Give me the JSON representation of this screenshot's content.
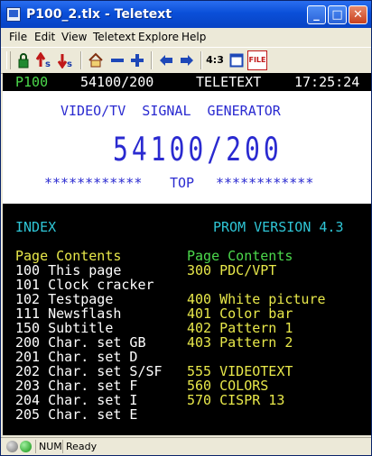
{
  "window": {
    "title": "P100_2.tlx - Teletext",
    "buttons": {
      "minimize": "_",
      "maximize": "□",
      "close": "✕"
    }
  },
  "menu": [
    "File",
    "Edit",
    "View",
    "Teletext",
    "Explore",
    "Help"
  ],
  "toolbar": {
    "buttons": [
      "lock",
      "prev-page",
      "next-page",
      "home",
      "minus",
      "plus",
      "back",
      "forward",
      "4:3",
      "window",
      "file"
    ],
    "ratio_label": "4:3",
    "file_label": "FILE"
  },
  "teletext": {
    "header": {
      "page": "P100",
      "counter": "54100/200",
      "service": "TELETEXT",
      "time": "17:25:24"
    },
    "banner": {
      "title": "VIDEO/TV  SIGNAL  GENERATOR",
      "big_number": "54100/200",
      "stars_left": "************",
      "top": "TOP",
      "stars_right": "************"
    },
    "index_label": "INDEX",
    "prom_version": "PROM VERSION 4.3",
    "col_header_left": "Page Contents",
    "col_header_right": "Page Contents",
    "left_rows": [
      "100 This page",
      "101 Clock cracker",
      "102 Testpage",
      "111 Newsflash",
      "150 Subtitle",
      "200 Char. set GB",
      "201 Char. set D",
      "202 Char. set S/SF",
      "203 Char. set F",
      "204 Char. set I",
      "205 Char. set E"
    ],
    "right_rows": [
      "300 PDC/VPT",
      "",
      "400 White picture",
      "401 Color bar",
      "402 Pattern 1",
      "403 Pattern 2",
      "",
      "555 VIDEOTEXT",
      "560 COLORS",
      "570 CISPR 13"
    ],
    "colors": {
      "green": "#4cd94c",
      "cyan": "#2fc6d6",
      "yellow": "#e8e84a",
      "white": "#ffffff",
      "blue": "#2a2ad0"
    }
  },
  "status": {
    "num": "NUM",
    "text": "Ready"
  }
}
